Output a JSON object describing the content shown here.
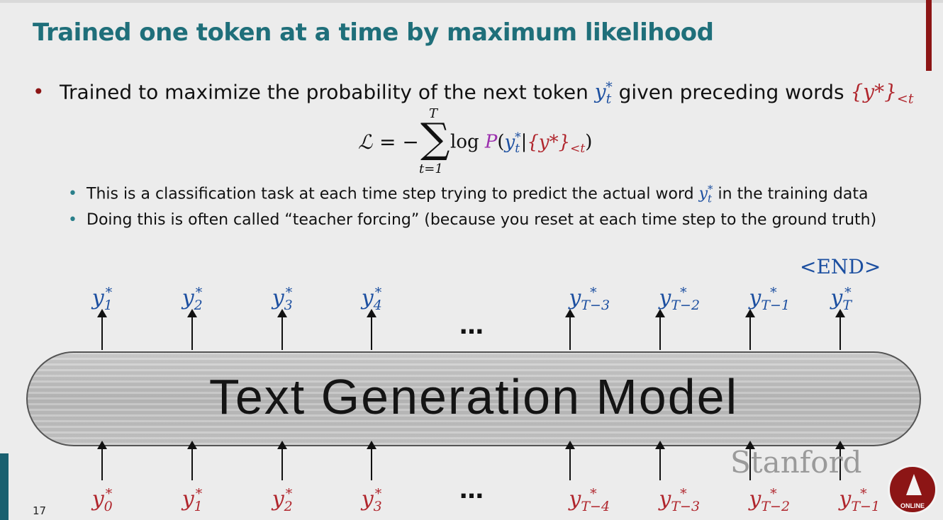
{
  "slide": {
    "title": "Trained one token at a time by maximum likelihood",
    "bullet_main_pre": "Trained to maximize the probability of the next token ",
    "bullet_main_token_base": "y",
    "bullet_main_token_sub": "t",
    "bullet_main_token_sup": "*",
    "bullet_main_mid": " given preceding words ",
    "bullet_main_context": "{y*}",
    "bullet_main_context_sub": "<t",
    "formula": {
      "lhs": "ℒ",
      "eq": "= −",
      "sigma": "∑",
      "upper": "T",
      "lower": "t=1",
      "log": "log ",
      "p": "P",
      "args_open": "(",
      "y": "y",
      "y_sub": "t",
      "y_sup": "*",
      "bar": "|",
      "ctx": "{y*}",
      "ctx_sub": "<t",
      "args_close": ")"
    },
    "sub_bullet_1_pre": "This is a classification task at each time step trying to predict the actual word ",
    "sub_bullet_1_token": "y",
    "sub_bullet_1_token_sub": "t",
    "sub_bullet_1_token_sup": "*",
    "sub_bullet_1_post": " in the training data",
    "sub_bullet_2": "Doing this is often called “teacher forcing” (because you reset at each time step to the ground truth)",
    "end_token": "<END>",
    "model_label": "Text Generation Model",
    "ellipsis": "…",
    "output_tokens": [
      {
        "base": "y",
        "sub": "1",
        "sup": "*"
      },
      {
        "base": "y",
        "sub": "2",
        "sup": "*"
      },
      {
        "base": "y",
        "sub": "3",
        "sup": "*"
      },
      {
        "base": "y",
        "sub": "4",
        "sup": "*"
      },
      {
        "base": "y",
        "sub": "T−3",
        "sup": "*"
      },
      {
        "base": "y",
        "sub": "T−2",
        "sup": "*"
      },
      {
        "base": "y",
        "sub": "T−1",
        "sup": "*"
      },
      {
        "base": "y",
        "sub": "T",
        "sup": "*"
      }
    ],
    "input_tokens": [
      {
        "base": "y",
        "sub": "0",
        "sup": "*"
      },
      {
        "base": "y",
        "sub": "1",
        "sup": "*"
      },
      {
        "base": "y",
        "sub": "2",
        "sup": "*"
      },
      {
        "base": "y",
        "sub": "3",
        "sup": "*"
      },
      {
        "base": "y",
        "sub": "T−4",
        "sup": "*"
      },
      {
        "base": "y",
        "sub": "T−3",
        "sup": "*"
      },
      {
        "base": "y",
        "sub": "T−2",
        "sup": "*"
      },
      {
        "base": "y",
        "sub": "T−1",
        "sup": "*"
      }
    ],
    "branding": {
      "word": "Stanford",
      "seal_text": "ONLINE"
    },
    "page_number": "17",
    "colors": {
      "title": "#1f6f7a",
      "token_blue": "#1c4fa0",
      "token_red": "#b0262d",
      "prob_purple": "#9b2fae",
      "stanford_red": "#8c1515"
    }
  }
}
